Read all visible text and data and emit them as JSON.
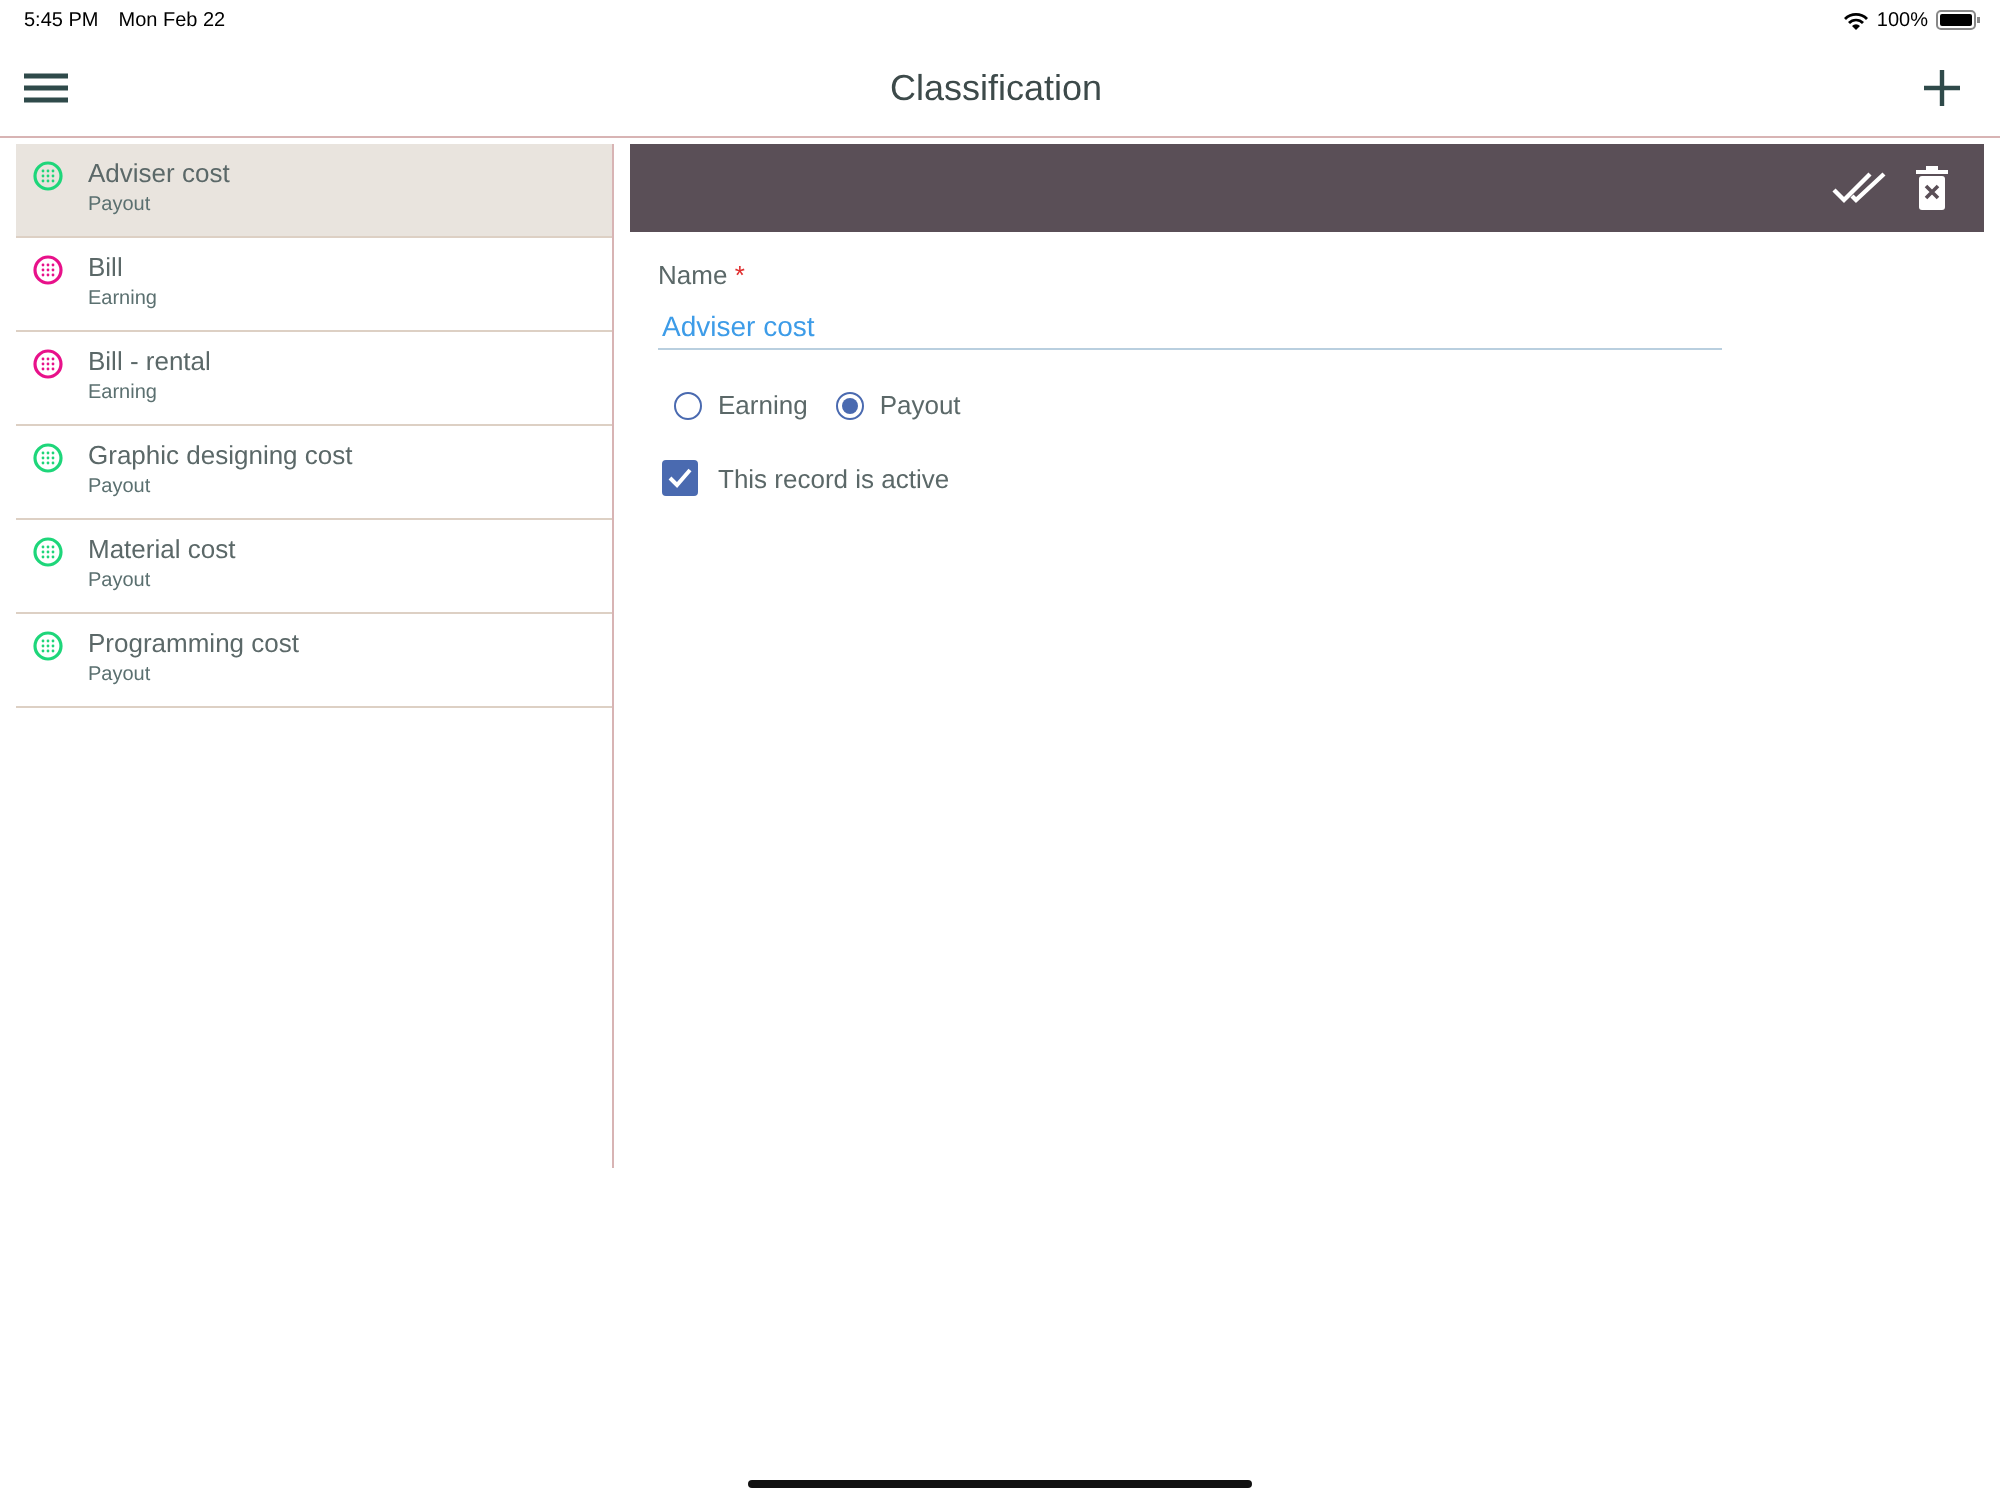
{
  "status_bar": {
    "time": "5:45 PM",
    "date": "Mon Feb 22",
    "battery": "100%"
  },
  "header": {
    "title": "Classification"
  },
  "list": [
    {
      "name": "Adviser cost",
      "type": "Payout",
      "color": "#1ed67a",
      "selected": true
    },
    {
      "name": "Bill",
      "type": "Earning",
      "color": "#e8118a",
      "selected": false
    },
    {
      "name": "Bill - rental",
      "type": "Earning",
      "color": "#e8118a",
      "selected": false
    },
    {
      "name": "Graphic designing cost",
      "type": "Payout",
      "color": "#1ed67a",
      "selected": false
    },
    {
      "name": "Material cost",
      "type": "Payout",
      "color": "#1ed67a",
      "selected": false
    },
    {
      "name": "Programming cost",
      "type": "Payout",
      "color": "#1ed67a",
      "selected": false
    }
  ],
  "form": {
    "name_label": "Name",
    "required_mark": "*",
    "name_value": "Adviser cost",
    "type_options": [
      {
        "label": "Earning",
        "selected": false
      },
      {
        "label": "Payout",
        "selected": true
      }
    ],
    "active": {
      "label": "This record is active",
      "checked": true
    }
  }
}
